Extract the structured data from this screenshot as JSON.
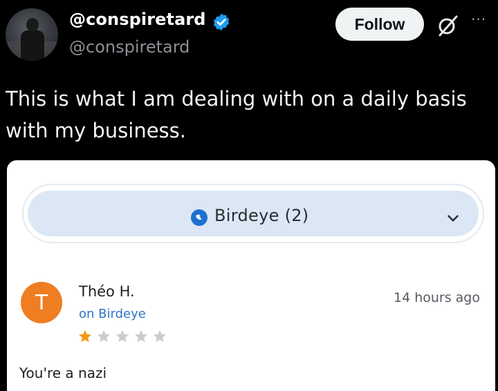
{
  "tweet": {
    "display_name": "@conspiretard",
    "handle": "@conspiretard",
    "follow_label": "Follow",
    "more_label": "···",
    "text_line1": "This is what I am dealing with on a daily basis",
    "text_line2": "with my business.",
    "icons": [
      "verified-badge-icon",
      "grok-icon",
      "more-icon"
    ]
  },
  "review_card": {
    "source_selector": "Birdeye (2)",
    "reviewer_initial": "T",
    "reviewer_name": "Théo H.",
    "source": "on Birdeye",
    "time": "14 hours ago",
    "rating": 1,
    "rating_max": 5,
    "text": "You're a nazi"
  },
  "colors": {
    "background": "#000000",
    "follow_button": "#eff3f4",
    "verified": "#1d9bf0",
    "selector_fill": "#dbe7f4",
    "reviewer_avatar": "#ef7d22",
    "source_link": "#2f73c6",
    "star_filled": "#f2991a",
    "star_empty": "#c9ccd1"
  }
}
